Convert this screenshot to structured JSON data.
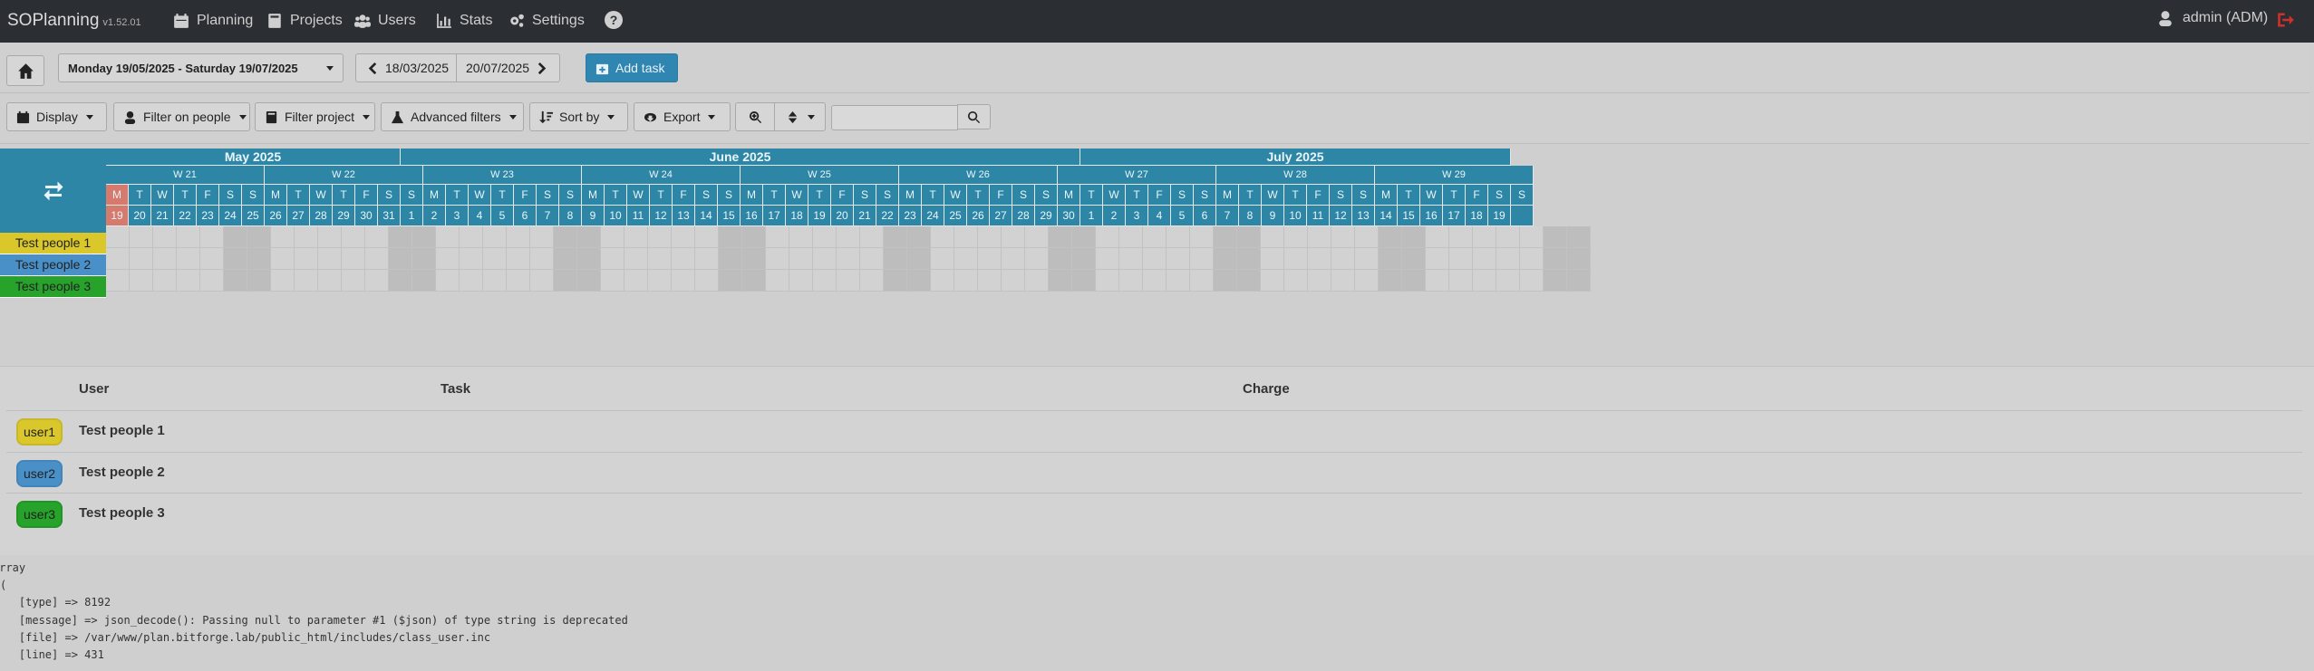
{
  "nav": {
    "brand": "SOPlanning",
    "version": "v1.52.01",
    "items": [
      {
        "label": "Planning",
        "icon": "calendar-icon"
      },
      {
        "label": "Projects",
        "icon": "book-icon"
      },
      {
        "label": "Users",
        "icon": "users-icon"
      },
      {
        "label": "Stats",
        "icon": "chart-icon"
      },
      {
        "label": "Settings",
        "icon": "gears-icon"
      }
    ],
    "help": "?",
    "user": "admin (ADM)"
  },
  "toolbar": {
    "date_range": "Monday 19/05/2025 - Saturday 19/07/2025",
    "prev_date": "18/03/2025",
    "next_date": "20/07/2025",
    "add_task": "Add task"
  },
  "filters": {
    "display": "Display",
    "filter_people": "Filter on people",
    "filter_project": "Filter project",
    "advanced": "Advanced filters",
    "sort": "Sort by",
    "export": "Export",
    "search_placeholder": ""
  },
  "calendar": {
    "months": [
      "May 2025",
      "June 2025",
      "July 2025"
    ],
    "weeks": [
      "W 21",
      "W 22",
      "W 23",
      "W 24",
      "W 25",
      "W 26",
      "W 27",
      "W 28",
      "W 29"
    ],
    "day_letters": [
      "M",
      "T",
      "W",
      "T",
      "F",
      "S",
      "S",
      "M",
      "T",
      "W",
      "T",
      "F",
      "S",
      "S",
      "M",
      "T",
      "W",
      "T",
      "F",
      "S",
      "S",
      "M",
      "T",
      "W",
      "T",
      "F",
      "S",
      "S",
      "M",
      "T",
      "W",
      "T",
      "F",
      "S",
      "S",
      "M",
      "T",
      "W",
      "T",
      "F",
      "S",
      "S",
      "M",
      "T",
      "W",
      "T",
      "F",
      "S",
      "S",
      "M",
      "T",
      "W",
      "T",
      "F",
      "S",
      "S",
      "M",
      "T",
      "W",
      "T",
      "F",
      "S",
      "S"
    ],
    "day_numbers": [
      "19",
      "20",
      "21",
      "22",
      "23",
      "24",
      "25",
      "26",
      "27",
      "28",
      "29",
      "30",
      "31",
      "1",
      "2",
      "3",
      "4",
      "5",
      "6",
      "7",
      "8",
      "9",
      "10",
      "11",
      "12",
      "13",
      "14",
      "15",
      "16",
      "17",
      "18",
      "19",
      "20",
      "21",
      "22",
      "23",
      "24",
      "25",
      "26",
      "27",
      "28",
      "29",
      "30",
      "1",
      "2",
      "3",
      "4",
      "5",
      "6",
      "7",
      "8",
      "9",
      "10",
      "11",
      "12",
      "13",
      "14",
      "15",
      "16",
      "17",
      "18",
      "19"
    ],
    "people": [
      {
        "name": "Test people 1",
        "color": "#d9c72c"
      },
      {
        "name": "Test people 2",
        "color": "#4a90c8"
      },
      {
        "name": "Test people 3",
        "color": "#27a22b"
      }
    ]
  },
  "users_table": {
    "headers": {
      "user": "User",
      "task": "Task",
      "charge": "Charge"
    },
    "rows": [
      {
        "badge": "user1",
        "name": "Test people 1",
        "color": "#d9c72c"
      },
      {
        "badge": "user2",
        "name": "Test people 2",
        "color": "#4a90c8"
      },
      {
        "badge": "user3",
        "name": "Test people 3",
        "color": "#27a22b"
      }
    ]
  },
  "debug": {
    "lines": [
      "Array",
      "(",
      "    [type] => 8192",
      "    [message] => json_decode(): Passing null to parameter #1 ($json) of type string is deprecated",
      "    [file] => /var/www/plan.bitforge.lab/public_html/includes/class_user.inc",
      "    [line] => 431"
    ]
  }
}
